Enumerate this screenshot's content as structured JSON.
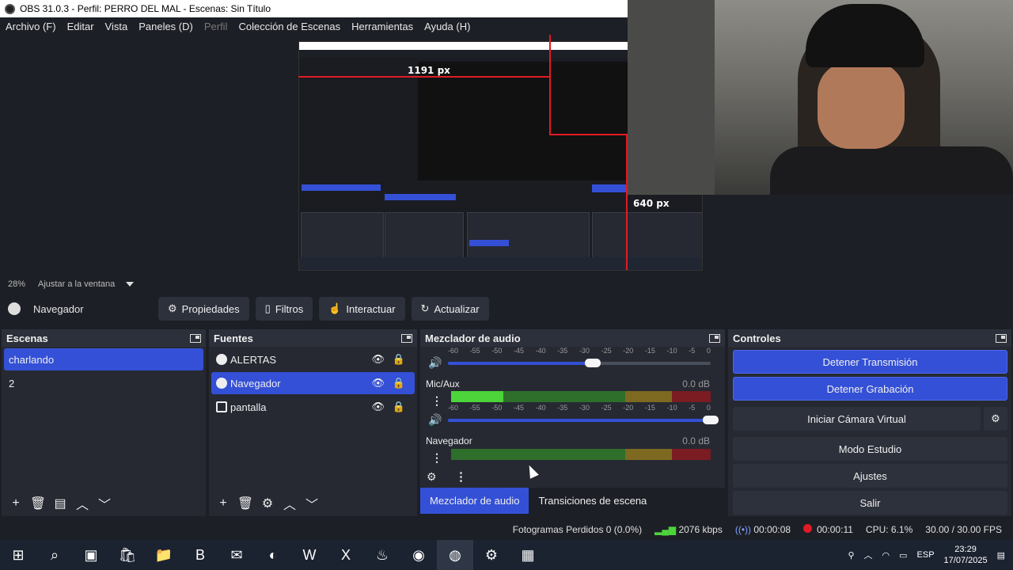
{
  "window": {
    "title": "OBS 31.0.3 - Perfil: PERRO DEL MAL - Escenas: Sin Título"
  },
  "menu": [
    {
      "label": "Archivo (F)",
      "enabled": true
    },
    {
      "label": "Editar",
      "enabled": true
    },
    {
      "label": "Vista",
      "enabled": true
    },
    {
      "label": "Paneles (D)",
      "enabled": true
    },
    {
      "label": "Perfil",
      "enabled": false
    },
    {
      "label": "Colección de Escenas",
      "enabled": true
    },
    {
      "label": "Herramientas",
      "enabled": true
    },
    {
      "label": "Ayuda (H)",
      "enabled": true
    }
  ],
  "preview": {
    "width_label": "1191 px",
    "height_label": "640 px",
    "zoom": "28%",
    "fit_label": "Ajustar a la ventana"
  },
  "source_toolbar": {
    "source_name": "Navegador",
    "properties": "Propiedades",
    "filters": "Filtros",
    "interact": "Interactuar",
    "refresh": "Actualizar"
  },
  "scenes": {
    "title": "Escenas",
    "items": [
      {
        "label": "charlando",
        "selected": true
      },
      {
        "label": "2",
        "selected": false
      }
    ]
  },
  "sources": {
    "title": "Fuentes",
    "items": [
      {
        "label": "ALERTAS",
        "selected": false
      },
      {
        "label": "Navegador",
        "selected": true
      },
      {
        "label": "pantalla",
        "selected": false
      }
    ]
  },
  "mixer": {
    "title": "Mezclador de audio",
    "scale": [
      "-60",
      "-55",
      "-50",
      "-45",
      "-40",
      "-35",
      "-30",
      "-25",
      "-20",
      "-15",
      "-10",
      "-5",
      "0"
    ],
    "channels": [
      {
        "name": "Mic/Aux",
        "db": "0.0 dB",
        "level": 0.2,
        "volume": 1.0
      },
      {
        "name": "Navegador",
        "db": "0.0 dB",
        "level": 0.0,
        "volume": 0.55
      }
    ],
    "top_channel_volume": 0.55
  },
  "tabs": [
    "Mezclador de audio",
    "Transiciones de escena"
  ],
  "controls": {
    "title": "Controles",
    "buttons": [
      {
        "label": "Detener Transmisión",
        "active": true
      },
      {
        "label": "Detener Grabación",
        "active": true
      },
      {
        "label": "Iniciar Cámara Virtual",
        "active": false
      },
      {
        "label": "Modo Estudio",
        "active": false
      },
      {
        "label": "Ajustes",
        "active": false
      },
      {
        "label": "Salir",
        "active": false
      }
    ]
  },
  "status": {
    "dropped": "Fotogramas Perdidos 0 (0.0%)",
    "bitrate": "2076 kbps",
    "stream_time": "00:00:08",
    "rec_time": "00:00:11",
    "cpu": "CPU: 6.1%",
    "fps": "30.00 / 30.00 FPS"
  },
  "taskbar": {
    "lang": "ESP",
    "time": "23:29",
    "date": "17/07/2025"
  },
  "colors": {
    "accent": "#3450d6",
    "record": "#e01b24"
  }
}
